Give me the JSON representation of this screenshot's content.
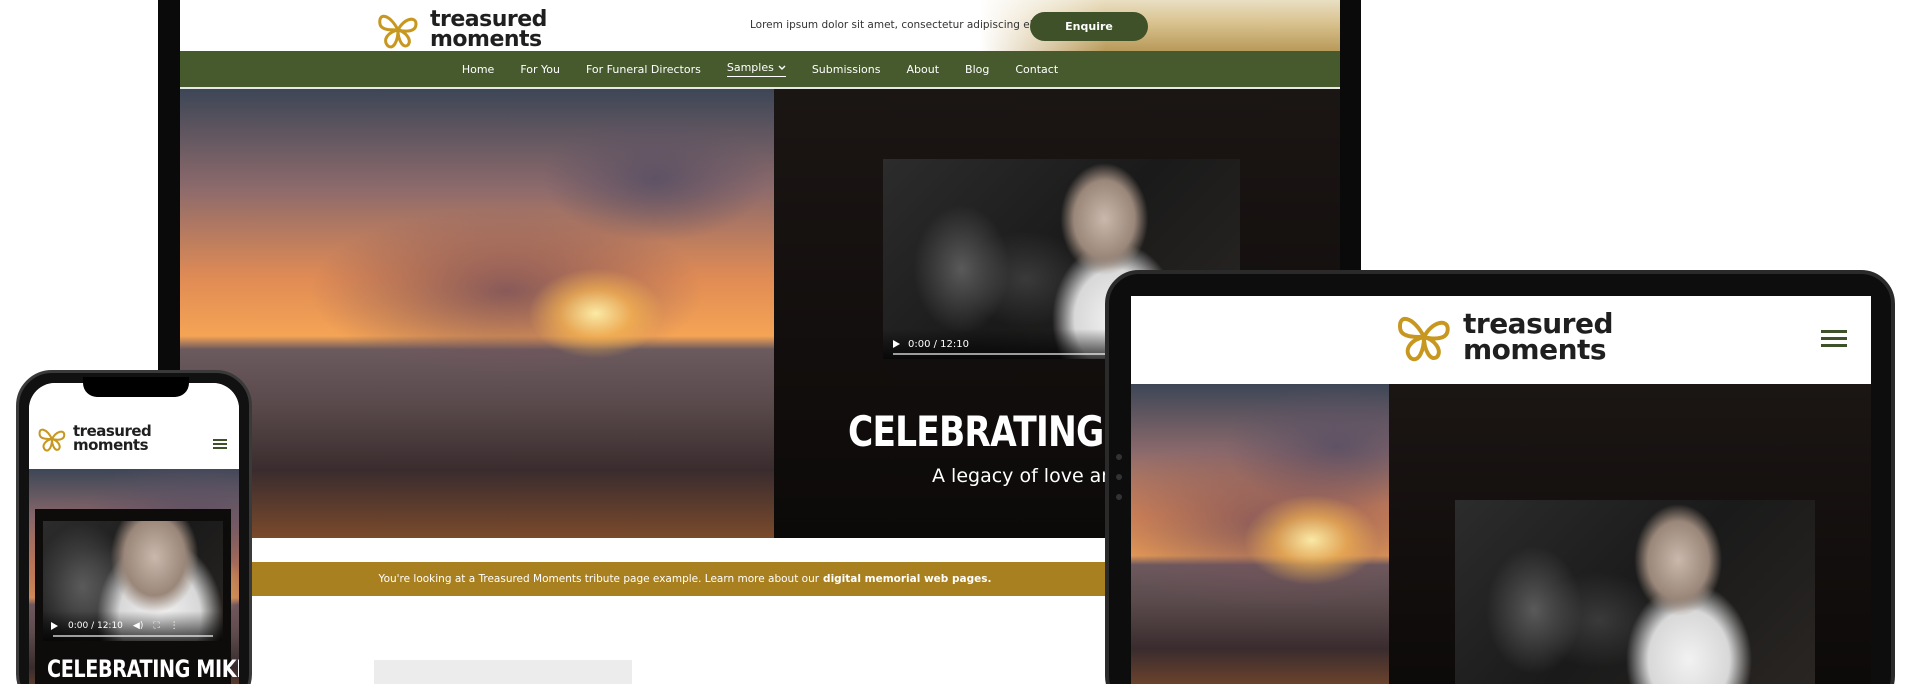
{
  "brand": {
    "logo_line1": "treasured",
    "logo_line2": "moments",
    "logo_color": "#c8971f",
    "nav_green": "#475a2e",
    "button_green": "#3e5128",
    "banner_gold": "#a9801f"
  },
  "desktop": {
    "tagline": "Lorem ipsum dolor sit amet, consectetur adipiscing elit",
    "enquire_label": "Enquire",
    "nav": [
      {
        "label": "Home"
      },
      {
        "label": "For You"
      },
      {
        "label": "For Funeral Directors"
      },
      {
        "label": "Samples",
        "has_dropdown": true,
        "active": true
      },
      {
        "label": "Submissions"
      },
      {
        "label": "About"
      },
      {
        "label": "Blog"
      },
      {
        "label": "Contact"
      }
    ],
    "video_time": "0:00 / 12:10",
    "hero_title": "CELEBRATING MI",
    "hero_subtitle": "A legacy of love and",
    "banner_text": "You're looking at a Treasured Moments tribute page example. Learn more about our",
    "banner_link": "digital memorial web pages."
  },
  "tablet": {
    "menu_icon": "hamburger-icon"
  },
  "phone": {
    "video_time": "0:00 / 12:10",
    "hero_title": "CELEBRATING MIKE",
    "menu_icon": "hamburger-icon"
  }
}
